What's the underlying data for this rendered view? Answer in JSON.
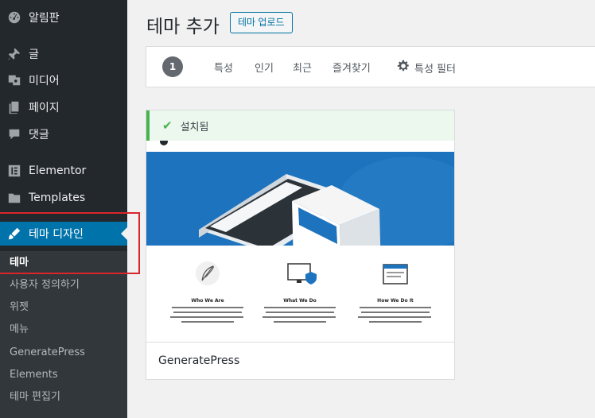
{
  "sidebar": {
    "items": [
      {
        "label": "알림판",
        "icon": "dashboard-icon"
      },
      {
        "label": "글",
        "icon": "pin-icon"
      },
      {
        "label": "미디어",
        "icon": "media-icon"
      },
      {
        "label": "페이지",
        "icon": "page-icon"
      },
      {
        "label": "댓글",
        "icon": "comment-icon"
      },
      {
        "label": "Elementor",
        "icon": "elementor-icon"
      },
      {
        "label": "Templates",
        "icon": "folder-icon"
      },
      {
        "label": "테마 디자인",
        "icon": "brush-icon"
      }
    ],
    "submenu": [
      "테마",
      "사용자 정의하기",
      "위젯",
      "메뉴",
      "GeneratePress",
      "Elements",
      "테마 편집기"
    ]
  },
  "header": {
    "title": "테마 추가",
    "upload_label": "테마 업로드"
  },
  "filter_bar": {
    "count": "1",
    "links": [
      "특성",
      "인기",
      "최근",
      "즐겨찾기"
    ],
    "feature_filter": "특성 필터"
  },
  "theme": {
    "installed_label": "설치됨",
    "name": "GeneratePress",
    "preview": {
      "sections": [
        {
          "title": "Who We Are",
          "icon": "feather-icon"
        },
        {
          "title": "What We Do",
          "icon": "monitor-shield-icon"
        },
        {
          "title": "How We Do It",
          "icon": "browser-window-icon"
        }
      ]
    }
  }
}
